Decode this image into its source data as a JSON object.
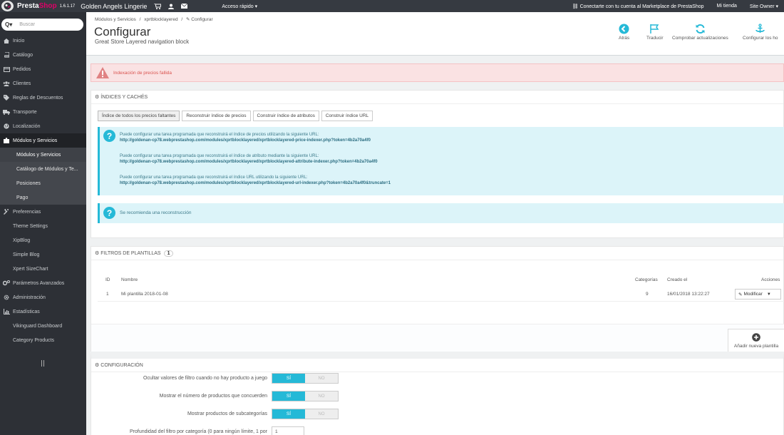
{
  "topbar": {
    "brand_presta": "Presta",
    "brand_shop": "Shop",
    "version": "1.6.1.17",
    "shop_name": "Golden Angels Lingerie",
    "quick_access": "Acceso rápido ▾",
    "marketplace": "Conectarte con tu cuenta al Marketplace de PrestaShop",
    "my_shop": "Mi tienda",
    "owner": "Site Owner ▾"
  },
  "sidebar": {
    "search_placeholder": "Buscar",
    "items": [
      {
        "label": "Inicio",
        "icon": "home-icon"
      },
      {
        "label": "Catálogo",
        "icon": "book-icon"
      },
      {
        "label": "Pedidos",
        "icon": "credit-card-icon"
      },
      {
        "label": "Clientes",
        "icon": "users-icon"
      },
      {
        "label": "Reglas de Descuentos",
        "icon": "tag-icon"
      },
      {
        "label": "Transporte",
        "icon": "truck-icon"
      },
      {
        "label": "Localización",
        "icon": "globe-icon"
      },
      {
        "label": "Módulos y Servicios",
        "icon": "puzzle-icon"
      },
      {
        "label": "Módulos y Servicios"
      },
      {
        "label": "Catálogo de Módulos y Te..."
      },
      {
        "label": "Posiciones"
      },
      {
        "label": "Pago"
      },
      {
        "label": "Preferencias",
        "icon": "wrench-icon"
      },
      {
        "label": "Theme Settings"
      },
      {
        "label": "XipBlog"
      },
      {
        "label": "Simple Blog"
      },
      {
        "label": "Xpert SizeChart"
      },
      {
        "label": "Parámetros Avanzados",
        "icon": "cogs-icon"
      },
      {
        "label": "Administración",
        "icon": "cog-icon"
      },
      {
        "label": "Estadísticas",
        "icon": "bar-chart-icon"
      },
      {
        "label": "Vikinguard Dashboard"
      },
      {
        "label": "Category Products"
      }
    ]
  },
  "header": {
    "breadcrumb_1": "Módulos y Servicios",
    "breadcrumb_sep": "/",
    "breadcrumb_2": "xprtblocklayered",
    "breadcrumb_3": "✎ Configurar",
    "title": "Configurar",
    "subtitle": "Great Store Layered navigation block",
    "buttons": {
      "back": "Atrás",
      "translate": "Traducir",
      "check_updates": "Comprobar actualizaciones",
      "hooks": "Configurar los ho"
    }
  },
  "alert": {
    "text": "Indexación de precios fallida"
  },
  "indexes": {
    "title": "Índices y cachés",
    "buttons": [
      "Índice de todos los precios faltantes",
      "Reconstruir índice de precios",
      "Construir índice de atributos",
      "Construir índice URL"
    ],
    "info": [
      {
        "text": "Puede configurar una tarea programada que reconstruirá el índice de precios utilizando la siguiente URL:",
        "url": "http://goldenan-cp78.webprestashop.com/modules/xprtblocklayered/xprtblocklayered-price-indexer.php?token=4b2a70a4f0"
      },
      {
        "text": "Puede configurar una tarea programada que reconstruirá el índice de atributo mediante la siguiente URL:",
        "url": "http://goldenan-cp78.webprestashop.com/modules/xprtblocklayered/xprtblocklayered-attribute-indexer.php?token=4b2a70a4f0"
      },
      {
        "text": "Puede configurar una tarea programada que reconstruirá el índice URL utilizando la siguiente URL:",
        "url": "http://goldenan-cp78.webprestashop.com/modules/xprtblocklayered/xprtblocklayered-url-indexer.php?token=4b2a70a4f0&truncate=1"
      }
    ],
    "recommend": "Se recomienda una reconstrucción"
  },
  "templates": {
    "title": "Filtros de plantillas",
    "count": "1",
    "columns": {
      "id": "ID",
      "name": "Nombre",
      "categories": "Categorías",
      "created": "Creado el",
      "actions": "Acciones"
    },
    "rows": [
      {
        "id": "1",
        "name": "Mi plantilla 2018-01-08",
        "categories": "9",
        "created": "16/01/2018 13:22:27",
        "action": "Modificar"
      }
    ],
    "add": "Añadir nueva plantilla"
  },
  "config": {
    "title": "Configuración",
    "yes": "SÍ",
    "no": "NO",
    "rows": [
      "Ocultar valores de filtro cuando no hay producto a juego",
      "Mostrar el número de productos que concuerden",
      "Mostrar productos de subcategorías",
      "Profundidad del filtro por categoría (0 para ningún límite, 1 por"
    ],
    "depth_value": "1"
  }
}
